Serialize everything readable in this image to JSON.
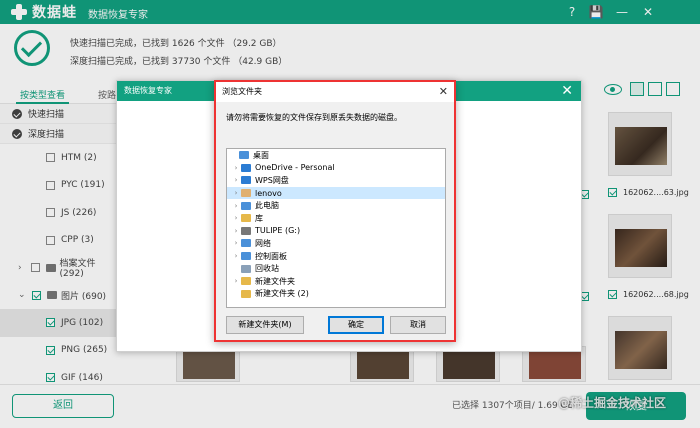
{
  "app": {
    "logo_text": "数据蛙",
    "title": "数据恢复专家",
    "controls": [
      "?",
      "💾",
      "—",
      "✕"
    ]
  },
  "status": {
    "quick_scan": "快速扫描已完成，已找到 1626 个文件 （29.2 GB）",
    "deep_scan": "深度扫描已完成，已找到 37730 个文件 （42.9 GB）"
  },
  "sidebar": {
    "tabs": [
      "按类型查看",
      "按路"
    ],
    "scans": [
      "快速扫描",
      "深度扫描"
    ],
    "tree": [
      {
        "label": "HTM (2)",
        "checked": false,
        "selected": false
      },
      {
        "label": "PYC (191)",
        "checked": false,
        "selected": false
      },
      {
        "label": "JS (226)",
        "checked": false,
        "selected": false
      },
      {
        "label": "CPP (3)",
        "checked": false,
        "selected": false
      },
      {
        "label": "档案文件 (292)",
        "checked": false,
        "selected": false,
        "expander": "›"
      },
      {
        "label": "图片 (690)",
        "checked": true,
        "selected": false,
        "expander": "⌄"
      },
      {
        "label": "JPG (102)",
        "checked": true,
        "selected": true
      },
      {
        "label": "PNG (265)",
        "checked": true,
        "selected": false
      },
      {
        "label": "GIF (146)",
        "checked": true,
        "selected": false
      }
    ]
  },
  "thumbnails": [
    {
      "label": "162062....63.jpg"
    },
    {
      "label": "162062....68.jpg"
    }
  ],
  "colors": {
    "accent": "#12a181",
    "dialog_border": "#e33333"
  },
  "parent_dialog": {
    "title": "数据恢复专家"
  },
  "browse_dialog": {
    "title": "浏览文件夹",
    "description": "请勿将需要恢复的文件保存到原丢失数据的磁盘。",
    "folders": [
      {
        "label": "桌面",
        "expander": "",
        "icon": "#4a90d9",
        "selected": false
      },
      {
        "label": "OneDrive - Personal",
        "expander": "›",
        "icon": "#2b7cd3",
        "selected": false
      },
      {
        "label": "WPS网盘",
        "expander": "›",
        "icon": "#2b7cd3",
        "selected": false
      },
      {
        "label": "lenovo",
        "expander": "›",
        "icon": "#e0b070",
        "selected": true
      },
      {
        "label": "此电脑",
        "expander": "›",
        "icon": "#4a90d9",
        "selected": false
      },
      {
        "label": "库",
        "expander": "›",
        "icon": "#e6b84a",
        "selected": false
      },
      {
        "label": "TULIPE (G:)",
        "expander": "›",
        "icon": "#777777",
        "selected": false
      },
      {
        "label": "网络",
        "expander": "›",
        "icon": "#4a90d9",
        "selected": false
      },
      {
        "label": "控制面板",
        "expander": "›",
        "icon": "#4a90d9",
        "selected": false
      },
      {
        "label": "回收站",
        "expander": "",
        "icon": "#8aa0b8",
        "selected": false
      },
      {
        "label": "新建文件夹",
        "expander": "›",
        "icon": "#e6b84a",
        "selected": false
      },
      {
        "label": "新建文件夹 (2)",
        "expander": "",
        "icon": "#e6b84a",
        "selected": false
      }
    ],
    "new_folder_label": "新建文件夹(M)",
    "ok_label": "确定",
    "cancel_label": "取消"
  },
  "bottom": {
    "back_label": "返回",
    "selected_info": "已选择 1307个项目/ 1.69 GB",
    "recover_label": "恢复",
    "watermark": "@稀土掘金技术社区"
  }
}
